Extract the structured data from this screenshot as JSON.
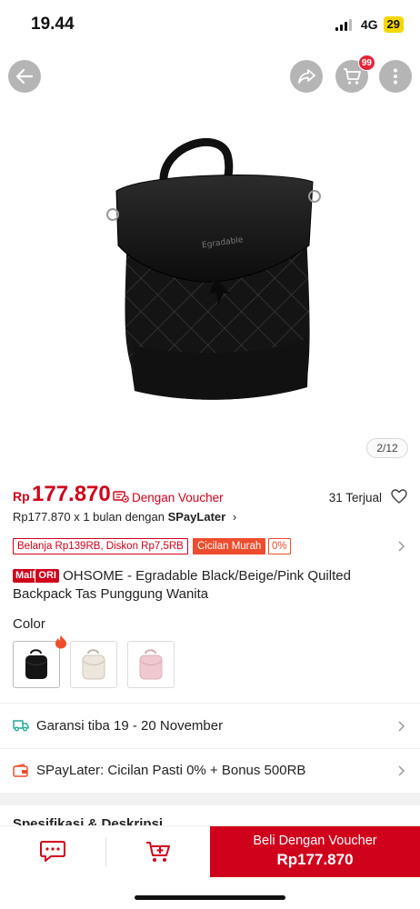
{
  "status_bar": {
    "time": "19.44",
    "network": "4G",
    "battery": "29"
  },
  "top_actions": {
    "cart_badge": "99"
  },
  "gallery": {
    "counter": "2/12"
  },
  "price": {
    "currency": "Rp",
    "amount": "177.870",
    "voucher_label": "Dengan Voucher",
    "sold": "31 Terjual"
  },
  "spaylater": {
    "text": "Rp177.870 x 1 bulan dengan ",
    "brand": "SPayLater",
    "chevron": "›"
  },
  "promos": {
    "discount": "Belanja Rp139RB, Diskon Rp7,5RB",
    "installment": "Cicilan Murah",
    "installment_rate": "0%"
  },
  "product": {
    "mall_badge": "Mall",
    "ori_badge": "ORI",
    "title": "OHSOME -  Egradable Black/Beige/Pink Quilted Backpack Tas Punggung Wanita"
  },
  "variants": {
    "label": "Color",
    "options": [
      "black",
      "beige",
      "pink"
    ]
  },
  "info": {
    "shipping": "Garansi tiba 19 - 20 November",
    "paylater": "SPayLater: Cicilan Pasti 0% + Bonus 500RB"
  },
  "spec_peek": "Spesifikasi & Deskripsi",
  "bottom_bar": {
    "buy_label": "Beli Dengan Voucher",
    "buy_price": "Rp177.870"
  },
  "colors": {
    "accent": "#d0011b",
    "orange": "#ee4d2d"
  }
}
